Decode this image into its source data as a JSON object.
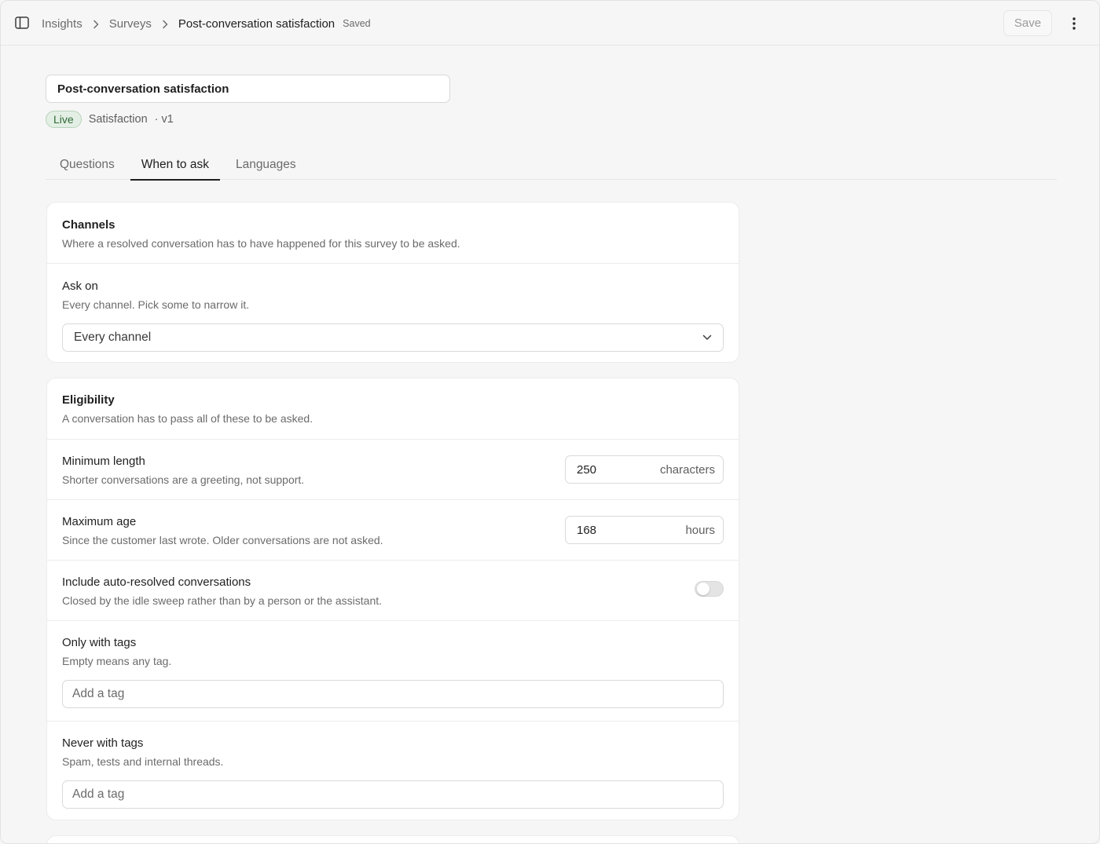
{
  "topbar": {
    "breadcrumb": [
      "Insights",
      "Surveys",
      "Post-conversation satisfaction"
    ],
    "saved_status": "Saved",
    "save_label": "Save"
  },
  "survey": {
    "title_value": "Post-conversation satisfaction",
    "status_badge": "Live",
    "kind": "Satisfaction",
    "version": "· v1"
  },
  "tabs": [
    {
      "label": "Questions",
      "active": false
    },
    {
      "label": "When to ask",
      "active": true
    },
    {
      "label": "Languages",
      "active": false
    }
  ],
  "channels": {
    "title": "Channels",
    "description": "Where a resolved conversation has to have happened for this survey to be asked.",
    "ask_on_label": "Ask on",
    "ask_on_description": "Every channel. Pick some to narrow it.",
    "ask_on_value": "Every channel"
  },
  "eligibility": {
    "title": "Eligibility",
    "description": "A conversation has to pass all of these to be asked.",
    "min_length_label": "Minimum length",
    "min_length_description": "Shorter conversations are a greeting, not support.",
    "min_length_value": "250",
    "min_length_unit": "characters",
    "max_age_label": "Maximum age",
    "max_age_description": "Since the customer last wrote. Older conversations are not asked.",
    "max_age_value": "168",
    "max_age_unit": "hours",
    "auto_resolved_label": "Include auto-resolved conversations",
    "auto_resolved_description": "Closed by the idle sweep rather than by a person or the assistant.",
    "auto_resolved_enabled": false,
    "only_tags_label": "Only with tags",
    "only_tags_description": "Empty means any tag.",
    "only_tags_placeholder": "Add a tag",
    "never_tags_label": "Never with tags",
    "never_tags_description": "Spam, tests and internal threads.",
    "never_tags_placeholder": "Add a tag"
  },
  "colors": {
    "live_badge_bg": "#e3efe4",
    "live_badge_text": "#2f6b38",
    "active_tab_underline": "#1f1f1f"
  }
}
